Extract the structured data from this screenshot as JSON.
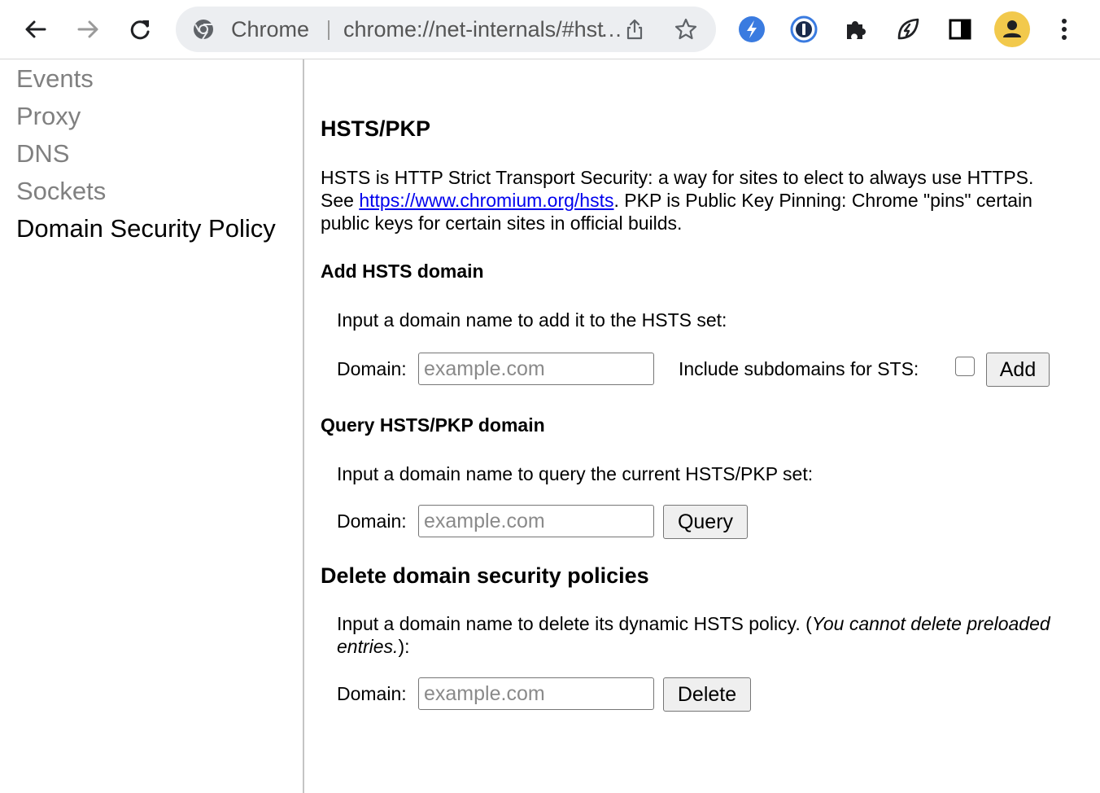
{
  "browser": {
    "chip_label": "Chrome",
    "url": "chrome://net-internals/#hsts",
    "icons": {
      "back": "back-arrow-icon",
      "forward": "forward-arrow-icon",
      "reload": "reload-icon",
      "share": "share-icon",
      "bookmark": "star-icon",
      "extensions": [
        "lightning-extension-icon",
        "1password-icon",
        "puzzle-extension-icon",
        "leaf-extension-icon",
        "side-panel-icon",
        "profile-avatar-icon",
        "kebab-menu-icon"
      ]
    },
    "colors": {
      "omnibox_bg": "#eceef1",
      "profile_bg": "#f2c94c",
      "ext_blue": "#3a7be0"
    }
  },
  "sidebar": {
    "items": [
      {
        "label": "Events",
        "active": false
      },
      {
        "label": "Proxy",
        "active": false
      },
      {
        "label": "DNS",
        "active": false
      },
      {
        "label": "Sockets",
        "active": false
      },
      {
        "label": "Domain Security Policy",
        "active": true
      }
    ]
  },
  "main": {
    "title": "HSTS/PKP",
    "description": {
      "before_link": "HSTS is HTTP Strict Transport Security: a way for sites to elect to always use HTTPS. See ",
      "link_text": "https://www.chromium.org/hsts",
      "after_link": ". PKP is Public Key Pinning: Chrome \"pins\" certain public keys for certain sites in official builds."
    },
    "add": {
      "heading": "Add HSTS domain",
      "instruction": "Input a domain name to add it to the HSTS set:",
      "domain_label": "Domain:",
      "placeholder": "example.com",
      "value": "",
      "subdomains_label": "Include subdomains for STS:",
      "subdomains_checked": false,
      "button": "Add"
    },
    "query": {
      "heading": "Query HSTS/PKP domain",
      "instruction": "Input a domain name to query the current HSTS/PKP set:",
      "domain_label": "Domain:",
      "placeholder": "example.com",
      "value": "",
      "button": "Query"
    },
    "delete": {
      "heading": "Delete domain security policies",
      "instruction_before": "Input a domain name to delete its dynamic HSTS policy. (",
      "instruction_note": "You cannot delete preloaded entries.",
      "instruction_after": "):",
      "domain_label": "Domain:",
      "placeholder": "example.com",
      "value": "",
      "button": "Delete"
    }
  }
}
